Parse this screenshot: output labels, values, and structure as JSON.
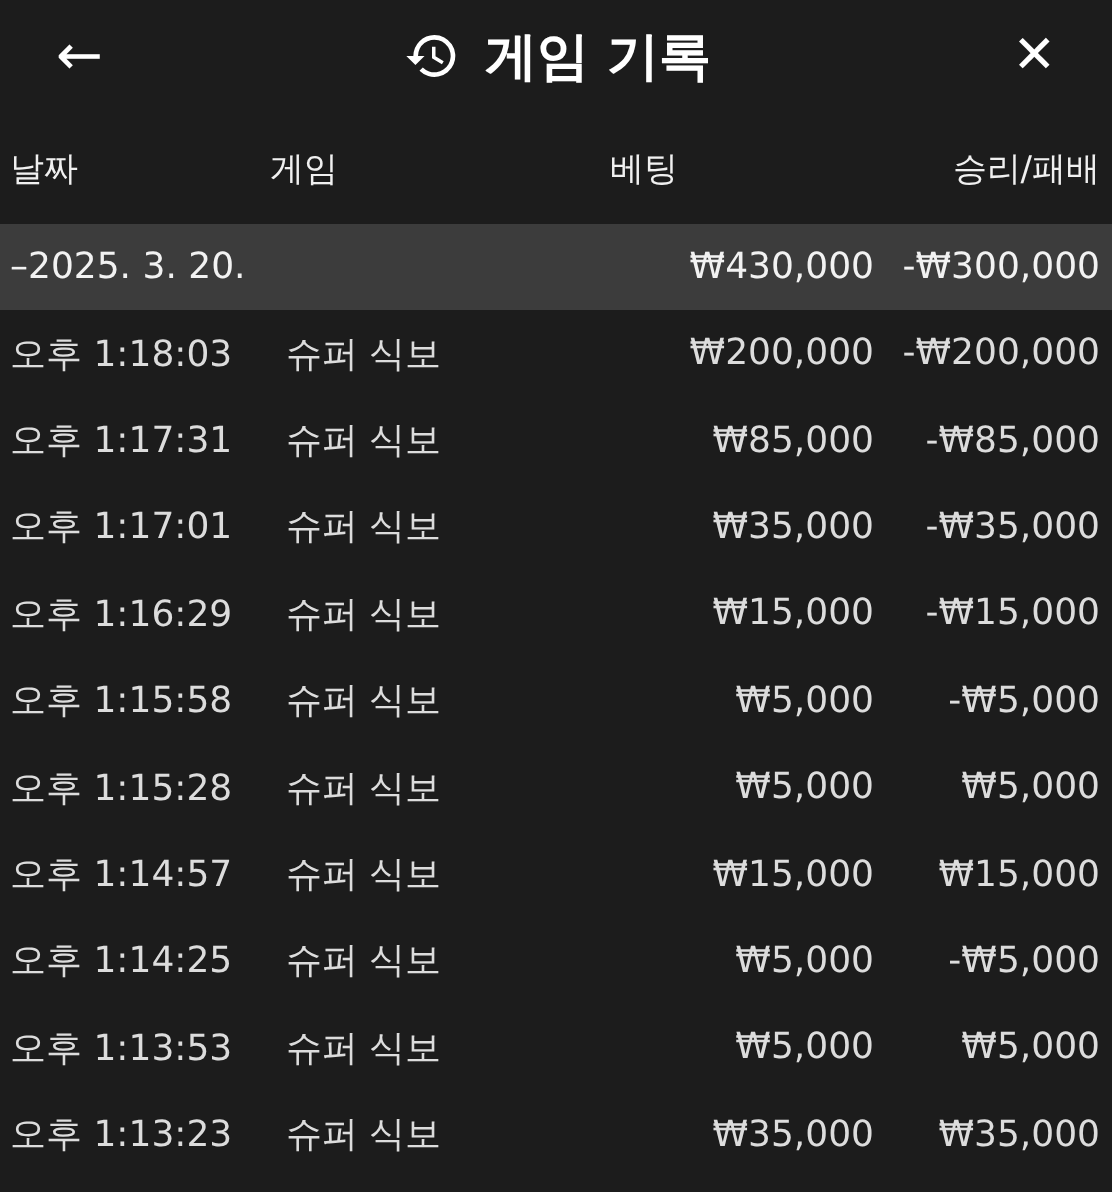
{
  "header": {
    "back": "←",
    "title": "게임 기록",
    "close": "✕"
  },
  "table": {
    "columns": [
      "날짜",
      "게임",
      "베팅",
      "승리/패배"
    ],
    "group": {
      "date": "–2025. 3. 20.",
      "bet": "₩430,000",
      "result": "-₩300,000"
    },
    "rows": [
      {
        "time": "오후 1:18:03",
        "game": "슈퍼 식보",
        "bet": "₩200,000",
        "result": "-₩200,000"
      },
      {
        "time": "오후 1:17:31",
        "game": "슈퍼 식보",
        "bet": "₩85,000",
        "result": "-₩85,000"
      },
      {
        "time": "오후 1:17:01",
        "game": "슈퍼 식보",
        "bet": "₩35,000",
        "result": "-₩35,000"
      },
      {
        "time": "오후 1:16:29",
        "game": "슈퍼 식보",
        "bet": "₩15,000",
        "result": "-₩15,000"
      },
      {
        "time": "오후 1:15:58",
        "game": "슈퍼 식보",
        "bet": "₩5,000",
        "result": "-₩5,000"
      },
      {
        "time": "오후 1:15:28",
        "game": "슈퍼 식보",
        "bet": "₩5,000",
        "result": "₩5,000"
      },
      {
        "time": "오후 1:14:57",
        "game": "슈퍼 식보",
        "bet": "₩15,000",
        "result": "₩15,000"
      },
      {
        "time": "오후 1:14:25",
        "game": "슈퍼 식보",
        "bet": "₩5,000",
        "result": "-₩5,000"
      },
      {
        "time": "오후 1:13:53",
        "game": "슈퍼 식보",
        "bet": "₩5,000",
        "result": "₩5,000"
      },
      {
        "time": "오후 1:13:23",
        "game": "슈퍼 식보",
        "bet": "₩35,000",
        "result": "₩35,000"
      }
    ]
  }
}
